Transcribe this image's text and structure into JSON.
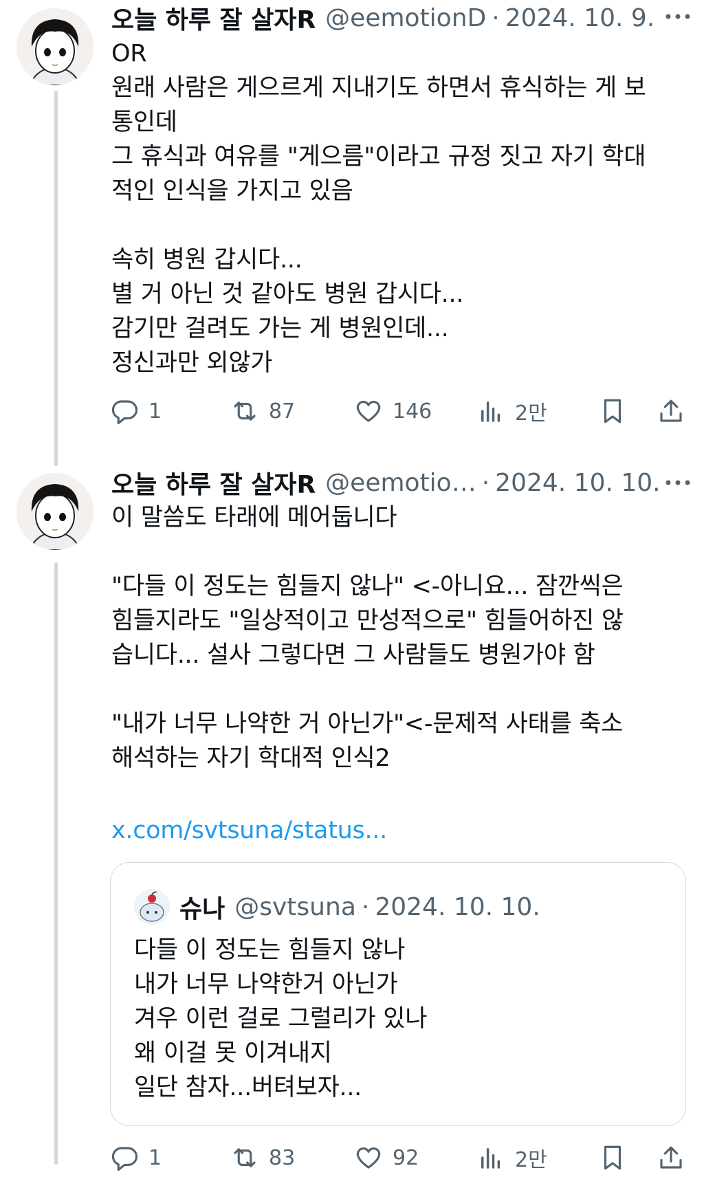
{
  "tweets": [
    {
      "display_name": "오늘 하루 잘 살자R",
      "handle": "@eemotionD",
      "separator": "·",
      "date": "2024. 10. 9.",
      "text": "OR\n원래 사람은 게으르게 지내기도 하면서 휴식하는 게 보\n통인데\n그 휴식과 여유를 \"게으름\"이라고 규정 짓고 자기 학대\n적인 인식을 가지고 있음\n\n속히 병원 갑시다...\n별 거 아닌 것 같아도 병원 갑시다...\n감기만 걸려도 가는 게 병원인데...\n정신과만 외않가",
      "actions": {
        "replies": "1",
        "retweets": "87",
        "likes": "146",
        "views": "2만"
      }
    },
    {
      "display_name": "오늘 하루 잘 살자R",
      "handle": "@eemotio…",
      "separator": "·",
      "date": "2024. 10. 10.",
      "text": "이 말씀도 타래에 메어둡니다\n\n\"다들 이 정도는 힘들지 않나\" <-아니요... 잠깐씩은\n힘들지라도 \"일상적이고 만성적으로\" 힘들어하진 않\n습니다... 설사 그렇다면 그 사람들도 병원가야 함\n\n\"내가 너무 나약한 거 아닌가\"<-문제적 사태를 축소\n해석하는 자기 학대적 인식2",
      "link": "x.com/svtsuna/status...",
      "quote": {
        "display_name": "슈나",
        "handle": "@svtsuna",
        "separator": "·",
        "date": "2024. 10. 10.",
        "text": "다들 이 정도는 힘들지 않나\n내가 너무 나약한거 아닌가\n겨우 이런 걸로 그럴리가 있나\n왜 이걸 못 이겨내지\n일단 참자...버텨보자..."
      },
      "actions": {
        "replies": "1",
        "retweets": "83",
        "likes": "92",
        "views": "2만"
      }
    }
  ],
  "icons": [
    "more-icon",
    "reply-icon",
    "retweet-icon",
    "like-icon",
    "views-icon",
    "bookmark-icon",
    "share-icon"
  ],
  "colors": {
    "text": "#0f1419",
    "secondary": "#536471",
    "link": "#1d9bf0",
    "border": "#cfd9de"
  }
}
